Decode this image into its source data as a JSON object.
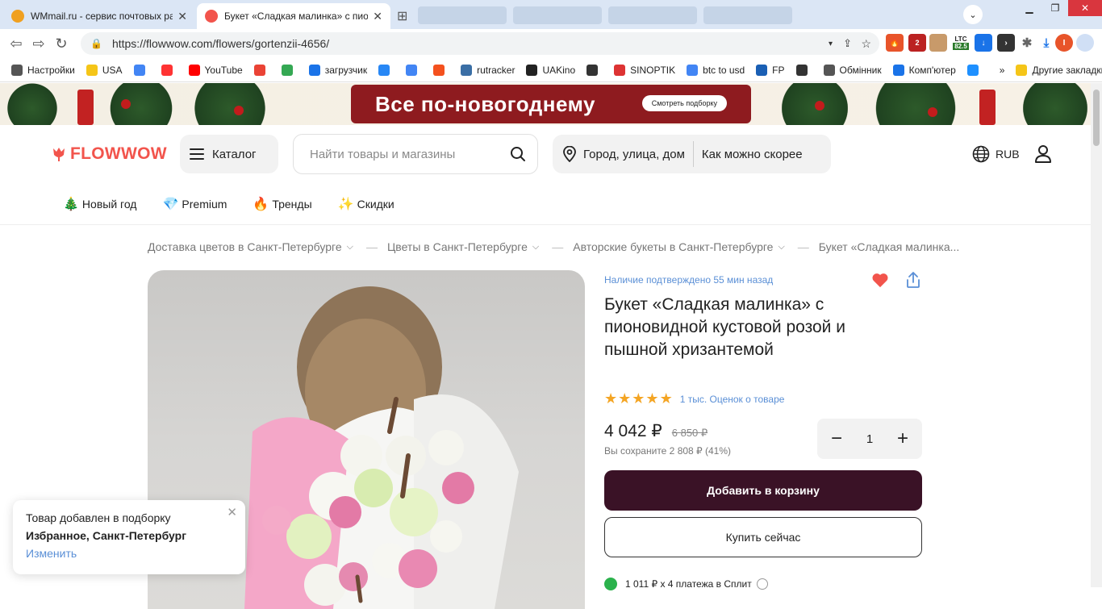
{
  "browser": {
    "tabs": [
      {
        "title": "WMmail.ru - сервис почтовых рассылок",
        "favicon_color": "#f0a020"
      },
      {
        "title": "Букет «Сладкая малинка» с пионовидной",
        "favicon_color": "#f2544c"
      }
    ],
    "url": "https://flowwow.com/flowers/gortenzii-4656/",
    "ext_ltc": "LTC",
    "ext_ltc_value": "82.5",
    "ext_badge": "2",
    "bookmarks": [
      {
        "label": "Настройки",
        "icon": "gear-icon",
        "color": "#555"
      },
      {
        "label": "USA",
        "icon": "folder-icon",
        "color": "#f5c518"
      },
      {
        "label": "",
        "icon": "google-icon",
        "color": "#4285f4"
      },
      {
        "label": "",
        "icon": "yandex-icon",
        "color": "#f33"
      },
      {
        "label": "YouTube",
        "icon": "youtube-icon",
        "color": "#ff0000"
      },
      {
        "label": "",
        "icon": "gmail-icon",
        "color": "#ea4335"
      },
      {
        "label": "",
        "icon": "drive-icon",
        "color": "#34a853"
      },
      {
        "label": "загрузчик",
        "icon": "loop-icon",
        "color": "#1a73e8"
      },
      {
        "label": "",
        "icon": "vk-icon",
        "color": "#2787f5"
      },
      {
        "label": "",
        "icon": "translate-icon",
        "color": "#4285f4"
      },
      {
        "label": "",
        "icon": "f-icon",
        "color": "#f4511e"
      },
      {
        "label": "rutracker",
        "icon": "rutracker-icon",
        "color": "#3a6ea5"
      },
      {
        "label": "UAKino",
        "icon": "uakino-icon",
        "color": "#222"
      },
      {
        "label": "",
        "icon": "figure-icon",
        "color": "#333"
      },
      {
        "label": "SINOPTIK",
        "icon": "thermometer-icon",
        "color": "#d33"
      },
      {
        "label": "btc to usd",
        "icon": "google-icon",
        "color": "#4285f4"
      },
      {
        "label": "FP",
        "icon": "fp-icon",
        "color": "#1a5fb4"
      },
      {
        "label": "",
        "icon": "bc-icon",
        "color": "#333"
      },
      {
        "label": "Обмінник",
        "icon": "exchange-icon",
        "color": "#555"
      },
      {
        "label": "Комп'ютер",
        "icon": "globe-icon",
        "color": "#1a73e8"
      },
      {
        "label": "",
        "icon": "star-icon",
        "color": "#1e90ff"
      }
    ],
    "bookmarks_more": "»",
    "other_bookmarks": "Другие закладки"
  },
  "banner": {
    "text": "Все по-новогоднему",
    "button": "Смотреть подборку"
  },
  "header": {
    "logo": "FLOWWOW",
    "catalog": "Каталог",
    "search_placeholder": "Найти товары и магазины",
    "location": "Город, улица, дом",
    "delivery": "Как можно скорее",
    "currency": "RUB"
  },
  "subnav": [
    {
      "emoji": "🎄",
      "label": "Новый год"
    },
    {
      "emoji": "💎",
      "label": "Premium"
    },
    {
      "emoji": "🔥",
      "label": "Тренды"
    },
    {
      "emoji": "✨",
      "label": "Скидки"
    }
  ],
  "breadcrumbs": [
    {
      "label": "Доставка цветов в Санкт-Петербурге",
      "chevron": true
    },
    {
      "label": "Цветы в Санкт-Петербурге",
      "chevron": true
    },
    {
      "label": "Авторские букеты в Санкт-Петербурге",
      "chevron": true
    },
    {
      "label": "Букет «Сладкая малинка...",
      "chevron": false
    }
  ],
  "product": {
    "confirmed": "Наличие подтверждено 55 мин назад",
    "title": "Букет «Сладкая малинка» с пионовидной кустовой розой и пышной хризантемой",
    "rating": 5,
    "ratings_text": "1 тыс. Оценок о товаре",
    "price": "4 042 ₽",
    "old_price": "6 850 ₽",
    "savings": "Вы сохраните 2 808 ₽ (41%)",
    "quantity": "1",
    "add_to_cart": "Добавить в корзину",
    "buy_now": "Купить сейчас",
    "split": "1 011 ₽ x 4 платежа в Сплит"
  },
  "toast": {
    "line1": "Товар добавлен в подборку",
    "line2": "Избранное, Санкт-Петербург",
    "action": "Изменить"
  }
}
